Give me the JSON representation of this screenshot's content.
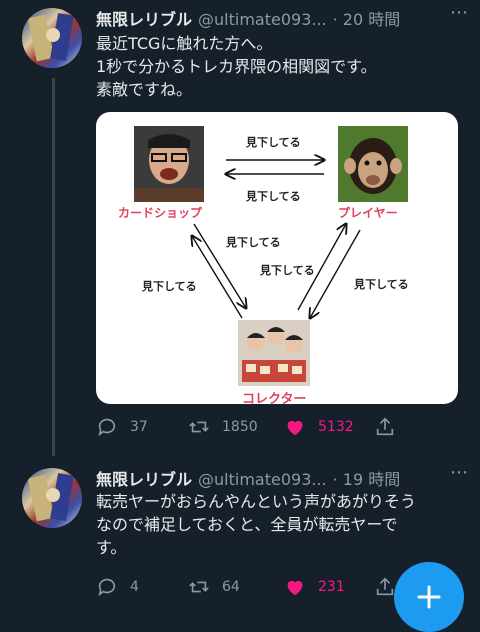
{
  "colors": {
    "background": "#15202b",
    "accent": "#1d9bf0",
    "like": "#f91880",
    "label": "#e0415e"
  },
  "tweets": [
    {
      "author": "無限レリブル",
      "handle": "@ultimate093...",
      "time": "· 20 時間",
      "lines": [
        "最近TCGに触れた方へ。",
        "1秒で分かるトレカ界隈の相関図です。",
        "素敵ですね。"
      ],
      "actions": {
        "reply": "37",
        "retweet": "1850",
        "like": "5132"
      }
    },
    {
      "author": "無限レリブル",
      "handle": "@ultimate093...",
      "time": "· 19 時間",
      "lines": [
        "転売ヤーがおらんやんという声があがりそう",
        "なので補足しておくと、全員が転売ヤーで",
        "す。"
      ],
      "actions": {
        "reply": "4",
        "retweet": "64",
        "like": "231"
      }
    }
  ],
  "diagram": {
    "nodes": {
      "shop": "カードショップ",
      "player": "プレイヤー",
      "collector": "コレクター"
    },
    "edge_label": "見下してる"
  },
  "icons": {
    "more": "more-icon",
    "reply": "reply-icon",
    "retweet": "retweet-icon",
    "like": "heart-icon",
    "share": "share-icon",
    "compose": "plus-icon"
  }
}
